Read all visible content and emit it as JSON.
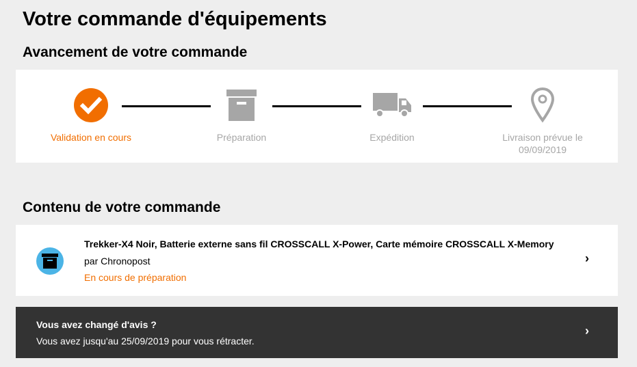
{
  "page": {
    "title": "Votre commande d'équipements"
  },
  "progress": {
    "title": "Avancement de votre commande",
    "steps": [
      {
        "label": "Validation en cours",
        "icon": "check-circle-icon",
        "active": true
      },
      {
        "label": "Préparation",
        "icon": "box-icon",
        "active": false
      },
      {
        "label": "Expédition",
        "icon": "truck-icon",
        "active": false
      },
      {
        "label": "Livraison prévue le 09/09/2019",
        "icon": "map-pin-icon",
        "active": false
      }
    ]
  },
  "content": {
    "title": "Contenu de votre commande",
    "order": {
      "name": "Trekker-X4 Noir, Batterie externe sans fil CROSSCALL X-Power, Carte mémoire CROSSCALL X-Memory",
      "carrier": "par Chronopost",
      "status": "En cours de préparation",
      "icon": "box-icon"
    }
  },
  "change_mind": {
    "title": "Vous avez changé d'avis ?",
    "text": "Vous avez jusqu'au 25/09/2019 pour vous rétracter."
  },
  "colors": {
    "accent": "#f16e00",
    "inactive": "#a6a6a6",
    "icon_blue": "#4bb4e6",
    "dark_panel": "#333333",
    "background": "#eeeeee"
  }
}
